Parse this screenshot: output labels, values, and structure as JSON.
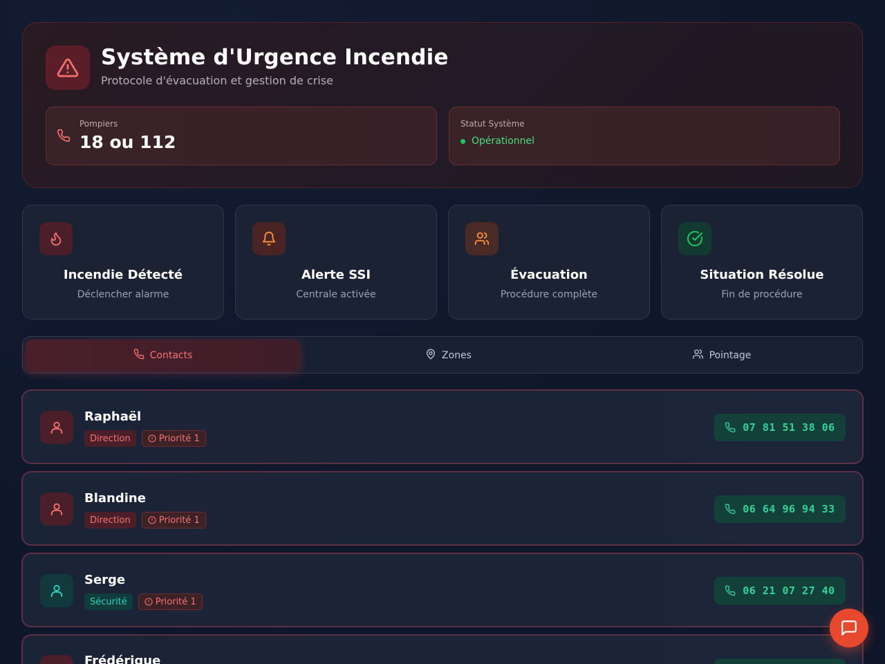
{
  "header": {
    "title": "Système d'Urgence Incendie",
    "subtitle": "Protocole d'évacuation et gestion de crise",
    "icon": "alert-triangle-icon"
  },
  "info": {
    "pompiers_label": "Pompiers",
    "pompiers_value": "18 ou 112",
    "status_label": "Statut Système",
    "status_value": "Opérationnel"
  },
  "steps": [
    {
      "title": "Incendie Détecté",
      "subtitle": "Déclencher alarme",
      "icon": "flame-icon",
      "color": "#f87171"
    },
    {
      "title": "Alerte SSI",
      "subtitle": "Centrale activée",
      "icon": "bell-icon",
      "color": "#fb923c"
    },
    {
      "title": "Évacuation",
      "subtitle": "Procédure complète",
      "icon": "users-icon",
      "color": "#fb923c"
    },
    {
      "title": "Situation Résolue",
      "subtitle": "Fin de procédure",
      "icon": "check-circle-icon",
      "color": "#22c55e"
    }
  ],
  "tabs": [
    {
      "label": "Contacts",
      "icon": "phone-icon",
      "active": true
    },
    {
      "label": "Zones",
      "icon": "map-pin-icon",
      "active": false
    },
    {
      "label": "Pointage",
      "icon": "users-icon",
      "active": false
    }
  ],
  "contacts": [
    {
      "name": "Raphaël",
      "role": "Direction",
      "priority": "Priorité 1",
      "phone": "07 81 51 38 06"
    },
    {
      "name": "Blandine",
      "role": "Direction",
      "priority": "Priorité 1",
      "phone": "06 64 96 94 33"
    },
    {
      "name": "Serge",
      "role": "Sécurité",
      "priority": "Priorité 1",
      "phone": "06 21 07 27 40"
    },
    {
      "name": "Frédérique",
      "role": "",
      "priority": "",
      "phone": ""
    }
  ],
  "colors": {
    "accent_red": "#f87171",
    "accent_green": "#34d399",
    "accent_teal": "#2dd4bf",
    "fab": "#e8482e"
  }
}
